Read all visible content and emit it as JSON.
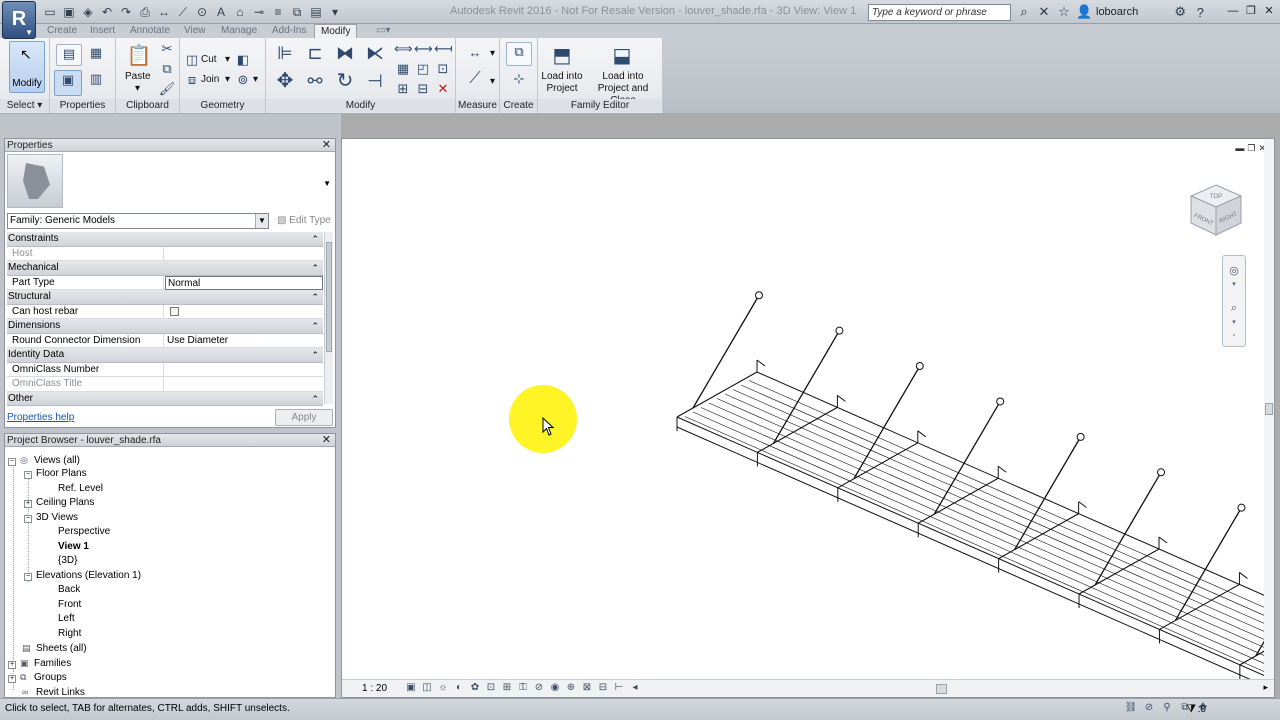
{
  "titlebar": {
    "title": "Autodesk Revit 2016 - Not For Resale Version -    louver_shade.rfa - 3D View: View 1",
    "search_placeholder": "Type a keyword or phrase",
    "user": "loboarch"
  },
  "ribbon_tabs": [
    {
      "label": "Create"
    },
    {
      "label": "Insert"
    },
    {
      "label": "Annotate"
    },
    {
      "label": "View"
    },
    {
      "label": "Manage"
    },
    {
      "label": "Add-Ins"
    },
    {
      "label": "Modify"
    }
  ],
  "ribbon": {
    "modify_label": "Modify",
    "paste_label": "Paste",
    "cut_label": "Cut",
    "join_label": "Join",
    "load_into_project": "Load into\nProject",
    "load_into_project_close": "Load into\nProject and Close",
    "panels": {
      "select": "Select",
      "properties": "Properties",
      "clipboard": "Clipboard",
      "geometry": "Geometry",
      "modify": "Modify",
      "measure": "Measure",
      "create": "Create",
      "family_editor": "Family Editor"
    }
  },
  "properties": {
    "header": "Properties",
    "family": "Family: Generic Models",
    "edit_type": "Edit Type",
    "sections": [
      {
        "name": "Constraints",
        "rows": [
          {
            "key": "Host",
            "value": "",
            "dim": true
          }
        ]
      },
      {
        "name": "Mechanical",
        "rows": [
          {
            "key": "Part Type",
            "value": "Normal",
            "editing": true
          }
        ]
      },
      {
        "name": "Structural",
        "rows": [
          {
            "key": "Can host rebar",
            "value": "",
            "checkbox": true
          }
        ]
      },
      {
        "name": "Dimensions",
        "rows": [
          {
            "key": "Round Connector Dimension",
            "value": "Use Diameter"
          }
        ]
      },
      {
        "name": "Identity Data",
        "rows": [
          {
            "key": "OmniClass Number",
            "value": ""
          },
          {
            "key": "OmniClass Title",
            "value": "",
            "dim": true
          }
        ]
      },
      {
        "name": "Other",
        "rows": []
      }
    ],
    "help_link": "Properties help",
    "apply_label": "Apply"
  },
  "browser": {
    "header": "Project Browser - louver_shade.rfa",
    "items": [
      {
        "label": "Views (all)",
        "level": 0,
        "expander": "-"
      },
      {
        "label": "Floor Plans",
        "level": 1,
        "expander": "-"
      },
      {
        "label": "Ref. Level",
        "level": 2
      },
      {
        "label": "Ceiling Plans",
        "level": 1,
        "expander": "+"
      },
      {
        "label": "3D Views",
        "level": 1,
        "expander": "-"
      },
      {
        "label": "Perspective",
        "level": 2
      },
      {
        "label": "View 1",
        "level": 2,
        "bold": true
      },
      {
        "label": "{3D}",
        "level": 2
      },
      {
        "label": "Elevations (Elevation 1)",
        "level": 1,
        "expander": "-"
      },
      {
        "label": "Back",
        "level": 2
      },
      {
        "label": "Front",
        "level": 2
      },
      {
        "label": "Left",
        "level": 2
      },
      {
        "label": "Right",
        "level": 2
      },
      {
        "label": "Sheets (all)",
        "level": 0
      },
      {
        "label": "Families",
        "level": 0,
        "expander": "+"
      },
      {
        "label": "Groups",
        "level": 0,
        "expander": "+"
      },
      {
        "label": "Revit Links",
        "level": 0
      }
    ]
  },
  "viewport": {
    "scale": "1 : 20",
    "viewcube": {
      "top": "TOP",
      "front": "FRONT",
      "right": "RIGHT"
    }
  },
  "status": {
    "text": "Click to select, TAB for alternates, CTRL adds, SHIFT unselects.",
    "filter_count": ":0"
  },
  "colors": {
    "highlight": "#fff200",
    "link": "#1a55b0"
  }
}
